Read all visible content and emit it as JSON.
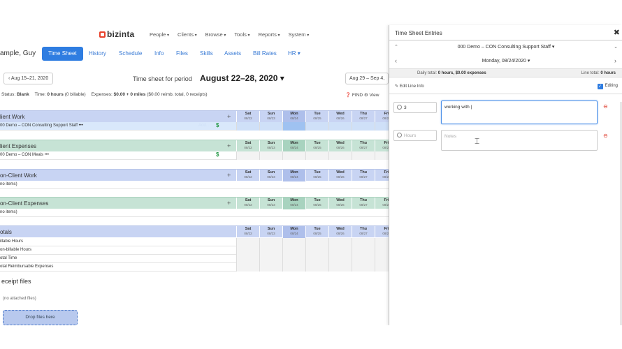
{
  "app": {
    "brand": "bizinta",
    "menu": [
      "People",
      "Clients",
      "Browse",
      "Tools",
      "Reports",
      "System"
    ]
  },
  "subnav": {
    "username": "ample, Guy",
    "tabs": [
      "Time Sheet",
      "History",
      "Schedule",
      "Info",
      "Files",
      "Skills",
      "Assets",
      "Bill Rates",
      "HR ▾"
    ],
    "active_tab": "Time Sheet"
  },
  "period": {
    "prev": "‹ Aug 15–21, 2020",
    "label": "Time sheet for period",
    "range": "August 22–28, 2020 ▾",
    "next": "Aug 29 – Sep 4,"
  },
  "status": {
    "status_label": "Status:",
    "status_value": "Blank",
    "time_label": "Time:",
    "time_value": "0 hours",
    "time_extra": "(0 billable)",
    "expenses_label": "Expenses:",
    "expenses_value": "$0.00 + 0 miles",
    "expenses_extra": "($0.00 reimb. total, 0 receipts)",
    "find": "❓ FIND  ⚙ View"
  },
  "days": [
    {
      "d": "Sat",
      "n": "08/22"
    },
    {
      "d": "Sun",
      "n": "08/23"
    },
    {
      "d": "Mon",
      "n": "08/24"
    },
    {
      "d": "Tue",
      "n": "08/25"
    },
    {
      "d": "Wed",
      "n": "08/26"
    },
    {
      "d": "Thu",
      "n": "08/27"
    },
    {
      "d": "Fri",
      "n": "08/28"
    }
  ],
  "sections": {
    "client_work": {
      "title": "lient Work",
      "row": "00 Demo – CON Consulting Support Staff •••",
      "ghost": "Add..."
    },
    "client_expenses": {
      "title": "lient Expenses",
      "row": "00 Demo – CON Meals •••"
    },
    "non_client_work": {
      "title": "on-Client Work",
      "row": "no items)"
    },
    "non_client_expenses": {
      "title": "on-Client Expenses",
      "row": "no items)"
    },
    "totals": {
      "title": "otals",
      "rows": [
        "illable Hours",
        "on-billable Hours",
        "otal Time",
        "otal Reimbursable Expenses"
      ]
    }
  },
  "receipts": {
    "title": "eceipt files",
    "empty": "(no attached files)",
    "drop": "Drop files here"
  },
  "panel": {
    "title": "Time Sheet Entries",
    "client": "000 Demo – CON Consulting Support Staff ▾",
    "date": "Monday, 08/24/2020 ▾",
    "daily_total_label": "Daily total:",
    "daily_total_value": "0 hours, $0.00 expenses",
    "line_total_label": "Line total:",
    "line_total_value": "0 hours",
    "edit_line_info": "✎  Edit Line Info",
    "editing": "Editing",
    "entries": [
      {
        "hours": "3",
        "notes": "working with |",
        "active": true
      },
      {
        "hours": "Hours",
        "notes": "Notes",
        "active": false
      }
    ]
  }
}
